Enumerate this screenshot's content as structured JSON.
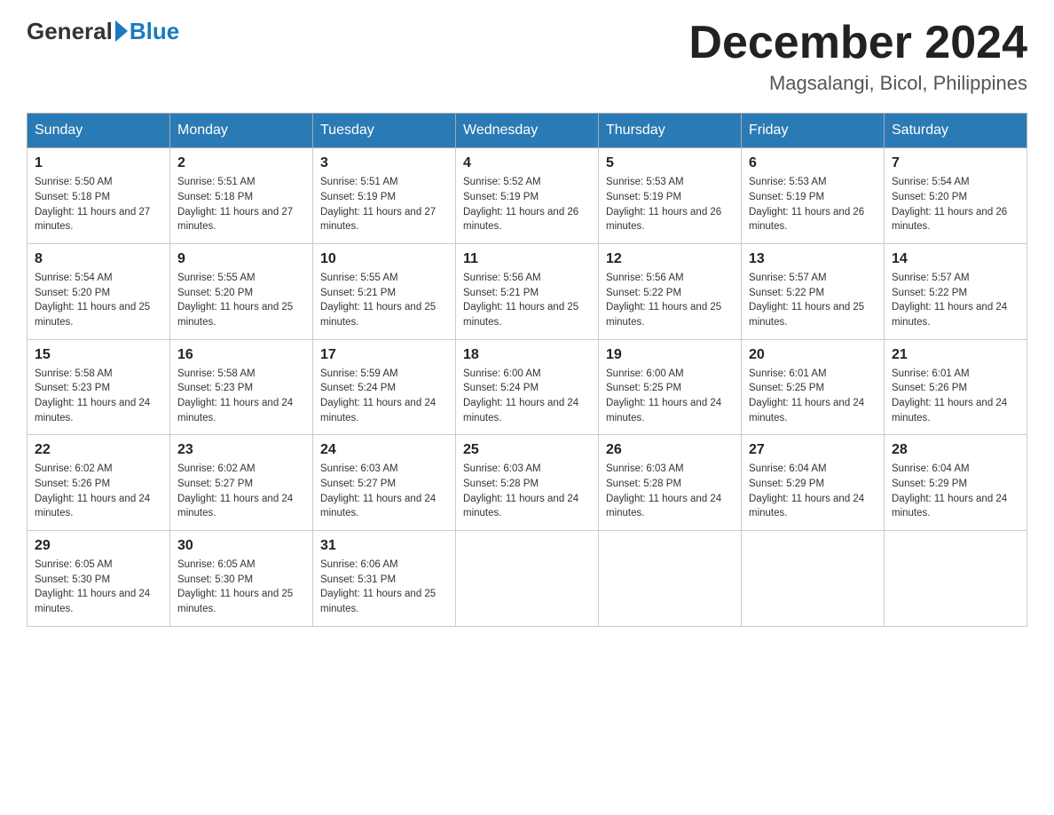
{
  "header": {
    "logo_general": "General",
    "logo_blue": "Blue",
    "month_title": "December 2024",
    "subtitle": "Magsalangi, Bicol, Philippines"
  },
  "days_of_week": [
    "Sunday",
    "Monday",
    "Tuesday",
    "Wednesday",
    "Thursday",
    "Friday",
    "Saturday"
  ],
  "weeks": [
    [
      {
        "day": "1",
        "sunrise": "5:50 AM",
        "sunset": "5:18 PM",
        "daylight": "11 hours and 27 minutes."
      },
      {
        "day": "2",
        "sunrise": "5:51 AM",
        "sunset": "5:18 PM",
        "daylight": "11 hours and 27 minutes."
      },
      {
        "day": "3",
        "sunrise": "5:51 AM",
        "sunset": "5:19 PM",
        "daylight": "11 hours and 27 minutes."
      },
      {
        "day": "4",
        "sunrise": "5:52 AM",
        "sunset": "5:19 PM",
        "daylight": "11 hours and 26 minutes."
      },
      {
        "day": "5",
        "sunrise": "5:53 AM",
        "sunset": "5:19 PM",
        "daylight": "11 hours and 26 minutes."
      },
      {
        "day": "6",
        "sunrise": "5:53 AM",
        "sunset": "5:19 PM",
        "daylight": "11 hours and 26 minutes."
      },
      {
        "day": "7",
        "sunrise": "5:54 AM",
        "sunset": "5:20 PM",
        "daylight": "11 hours and 26 minutes."
      }
    ],
    [
      {
        "day": "8",
        "sunrise": "5:54 AM",
        "sunset": "5:20 PM",
        "daylight": "11 hours and 25 minutes."
      },
      {
        "day": "9",
        "sunrise": "5:55 AM",
        "sunset": "5:20 PM",
        "daylight": "11 hours and 25 minutes."
      },
      {
        "day": "10",
        "sunrise": "5:55 AM",
        "sunset": "5:21 PM",
        "daylight": "11 hours and 25 minutes."
      },
      {
        "day": "11",
        "sunrise": "5:56 AM",
        "sunset": "5:21 PM",
        "daylight": "11 hours and 25 minutes."
      },
      {
        "day": "12",
        "sunrise": "5:56 AM",
        "sunset": "5:22 PM",
        "daylight": "11 hours and 25 minutes."
      },
      {
        "day": "13",
        "sunrise": "5:57 AM",
        "sunset": "5:22 PM",
        "daylight": "11 hours and 25 minutes."
      },
      {
        "day": "14",
        "sunrise": "5:57 AM",
        "sunset": "5:22 PM",
        "daylight": "11 hours and 24 minutes."
      }
    ],
    [
      {
        "day": "15",
        "sunrise": "5:58 AM",
        "sunset": "5:23 PM",
        "daylight": "11 hours and 24 minutes."
      },
      {
        "day": "16",
        "sunrise": "5:58 AM",
        "sunset": "5:23 PM",
        "daylight": "11 hours and 24 minutes."
      },
      {
        "day": "17",
        "sunrise": "5:59 AM",
        "sunset": "5:24 PM",
        "daylight": "11 hours and 24 minutes."
      },
      {
        "day": "18",
        "sunrise": "6:00 AM",
        "sunset": "5:24 PM",
        "daylight": "11 hours and 24 minutes."
      },
      {
        "day": "19",
        "sunrise": "6:00 AM",
        "sunset": "5:25 PM",
        "daylight": "11 hours and 24 minutes."
      },
      {
        "day": "20",
        "sunrise": "6:01 AM",
        "sunset": "5:25 PM",
        "daylight": "11 hours and 24 minutes."
      },
      {
        "day": "21",
        "sunrise": "6:01 AM",
        "sunset": "5:26 PM",
        "daylight": "11 hours and 24 minutes."
      }
    ],
    [
      {
        "day": "22",
        "sunrise": "6:02 AM",
        "sunset": "5:26 PM",
        "daylight": "11 hours and 24 minutes."
      },
      {
        "day": "23",
        "sunrise": "6:02 AM",
        "sunset": "5:27 PM",
        "daylight": "11 hours and 24 minutes."
      },
      {
        "day": "24",
        "sunrise": "6:03 AM",
        "sunset": "5:27 PM",
        "daylight": "11 hours and 24 minutes."
      },
      {
        "day": "25",
        "sunrise": "6:03 AM",
        "sunset": "5:28 PM",
        "daylight": "11 hours and 24 minutes."
      },
      {
        "day": "26",
        "sunrise": "6:03 AM",
        "sunset": "5:28 PM",
        "daylight": "11 hours and 24 minutes."
      },
      {
        "day": "27",
        "sunrise": "6:04 AM",
        "sunset": "5:29 PM",
        "daylight": "11 hours and 24 minutes."
      },
      {
        "day": "28",
        "sunrise": "6:04 AM",
        "sunset": "5:29 PM",
        "daylight": "11 hours and 24 minutes."
      }
    ],
    [
      {
        "day": "29",
        "sunrise": "6:05 AM",
        "sunset": "5:30 PM",
        "daylight": "11 hours and 24 minutes."
      },
      {
        "day": "30",
        "sunrise": "6:05 AM",
        "sunset": "5:30 PM",
        "daylight": "11 hours and 25 minutes."
      },
      {
        "day": "31",
        "sunrise": "6:06 AM",
        "sunset": "5:31 PM",
        "daylight": "11 hours and 25 minutes."
      },
      null,
      null,
      null,
      null
    ]
  ]
}
